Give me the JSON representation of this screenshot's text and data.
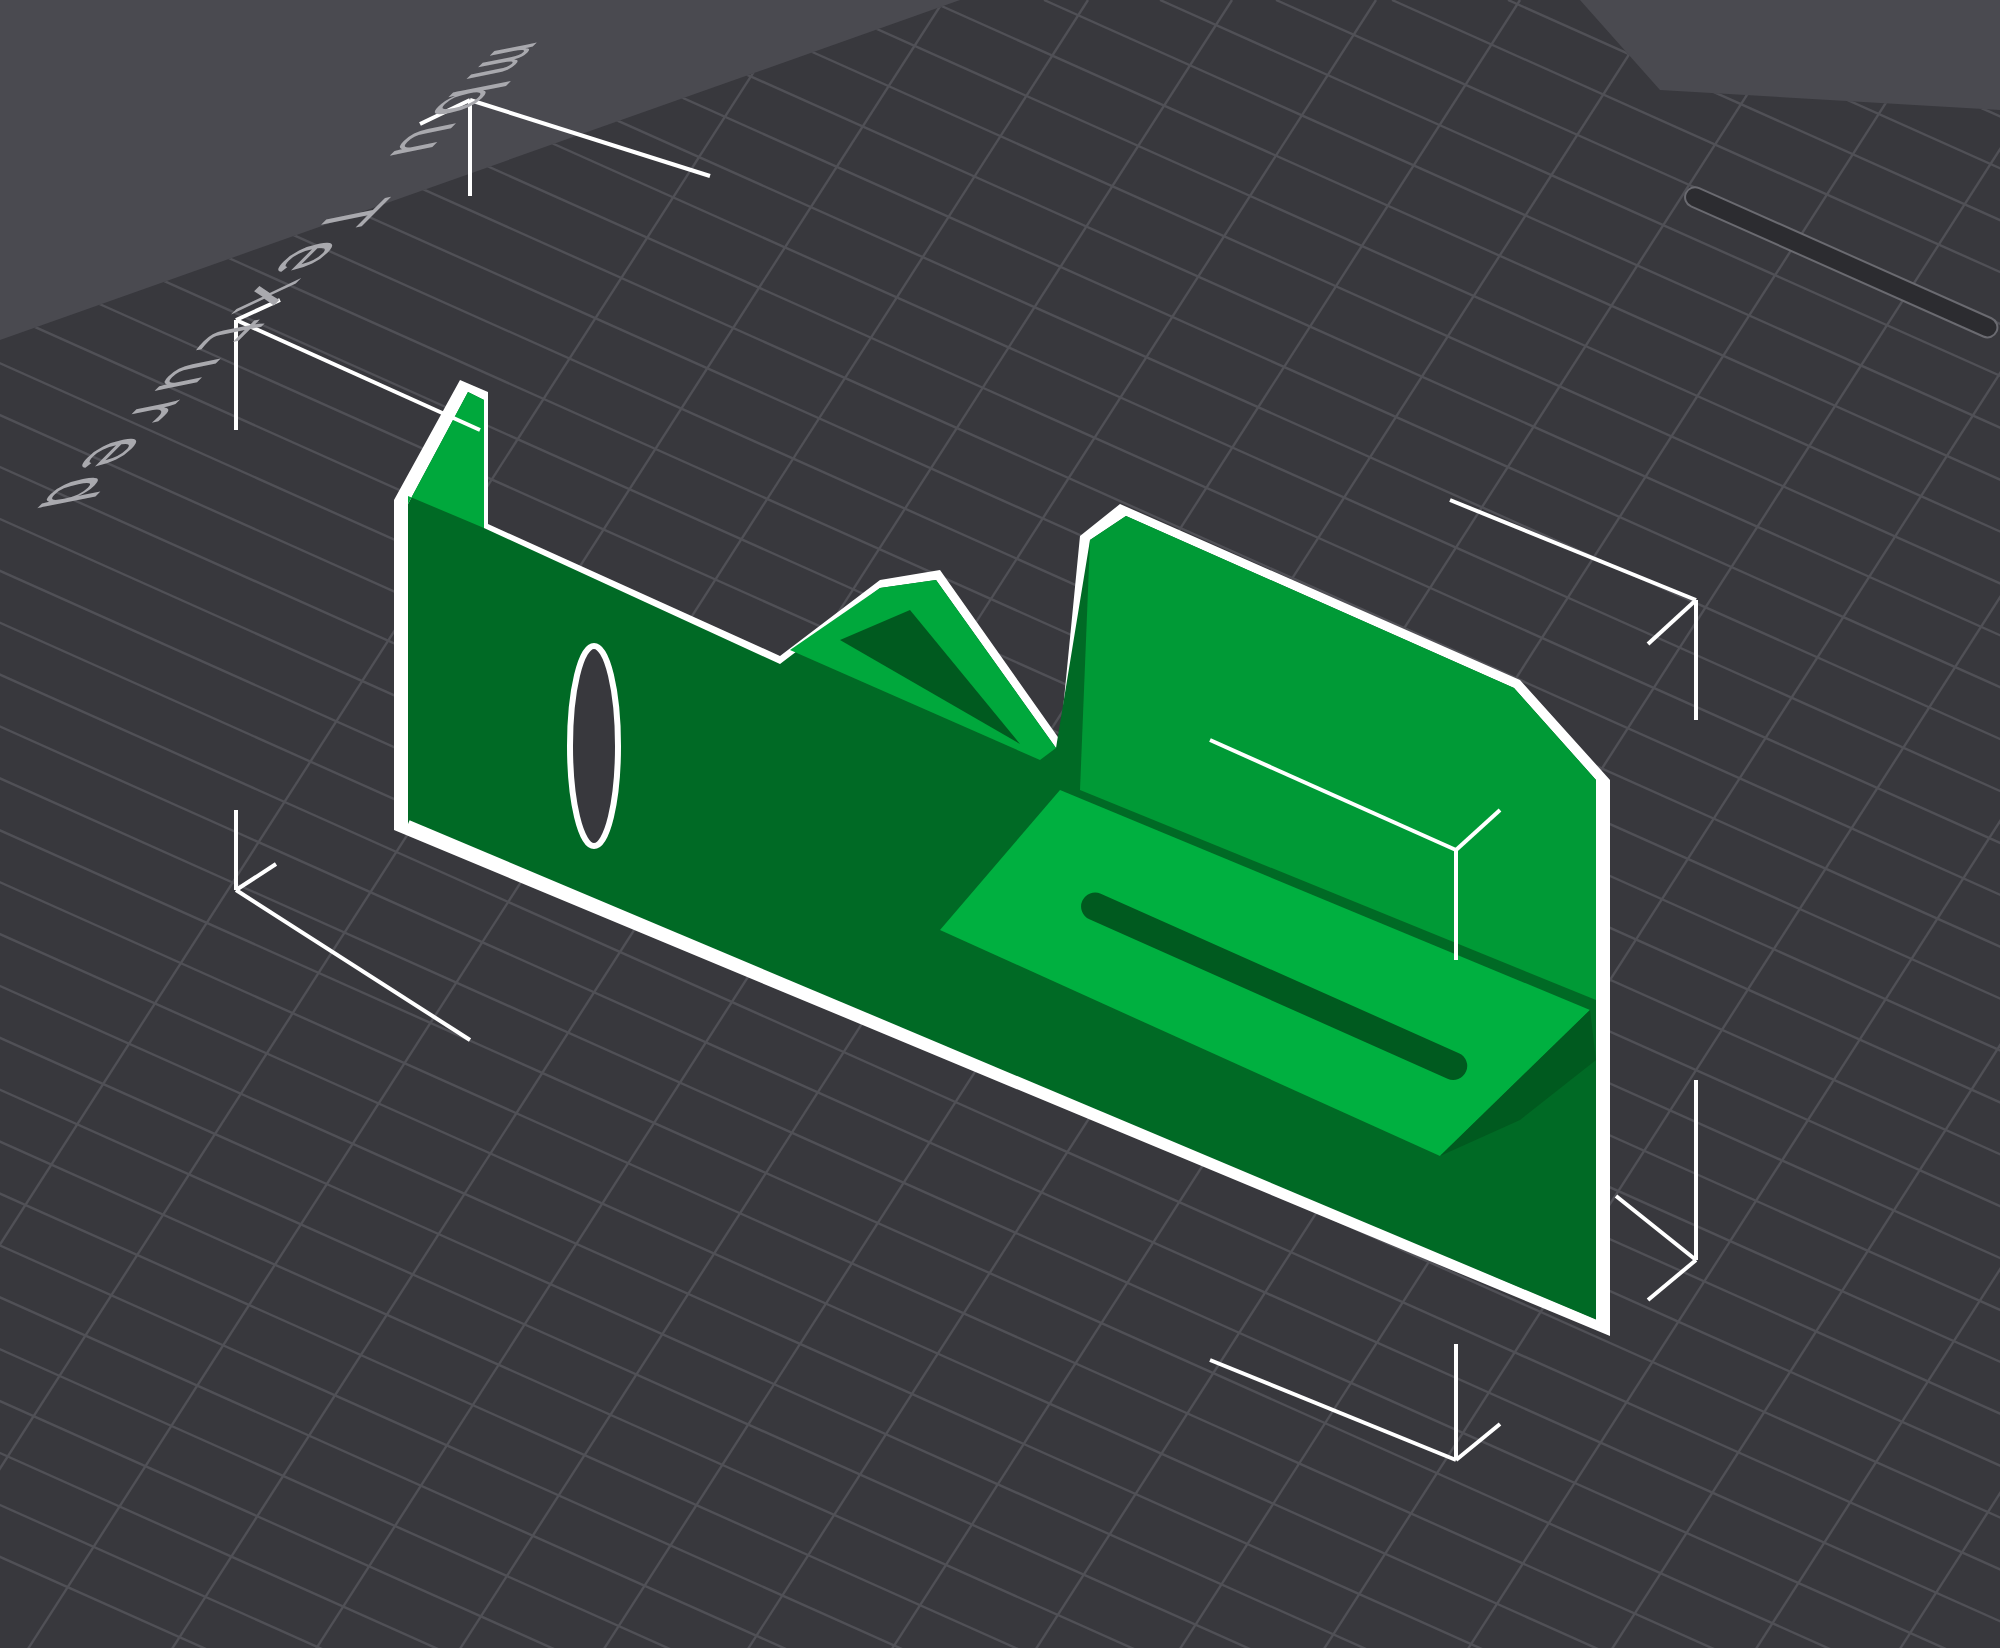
{
  "viewport": {
    "bed_label": "mbu Textured"
  }
}
